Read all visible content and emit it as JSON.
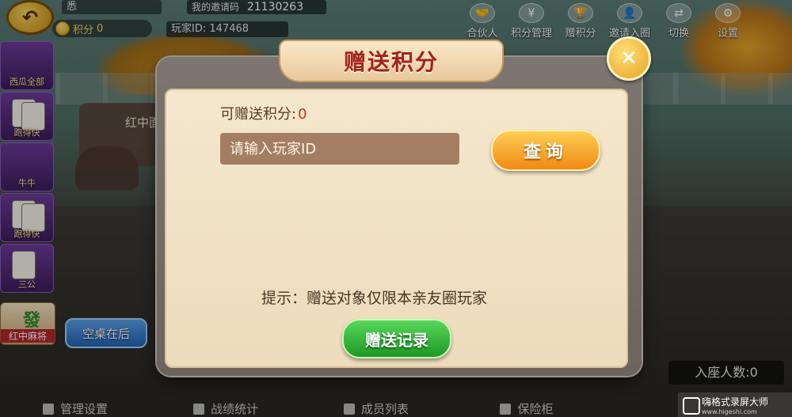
{
  "header": {
    "player_name": "悉",
    "points_label": "积分",
    "points_value": "0",
    "invite_label": "我的邀请码",
    "invite_code": "21130263",
    "player_id_label": "玩家ID:",
    "player_id": "147468"
  },
  "top_nav": [
    {
      "label": "合伙人",
      "icon": "handshake-icon",
      "glyph": "🤝"
    },
    {
      "label": "积分管理",
      "icon": "yen-icon",
      "glyph": "¥"
    },
    {
      "label": "赠积分",
      "icon": "trophy-icon",
      "glyph": "🏆"
    },
    {
      "label": "邀请入圈",
      "icon": "user-add-icon",
      "glyph": "👤"
    },
    {
      "label": "切换",
      "icon": "switch-icon",
      "glyph": "⇄"
    },
    {
      "label": "设置",
      "icon": "gear-icon",
      "glyph": "⚙"
    }
  ],
  "left_games": [
    {
      "label": "西瓜全部"
    },
    {
      "label": "跑得快"
    },
    {
      "label": "牛牛"
    },
    {
      "label": "跑得快"
    },
    {
      "label": "三公"
    }
  ],
  "left_hongzhong": {
    "label": "红中麻将",
    "tile_glyph": "發"
  },
  "background": {
    "table_label": "红中面"
  },
  "empty_table_button": "空桌在后",
  "seated_count": "入座人数:0",
  "bottom_bar": [
    {
      "label": "管理设置"
    },
    {
      "label": "战绩统计"
    },
    {
      "label": "成员列表"
    },
    {
      "label": "保险柜"
    }
  ],
  "watermark": {
    "title": "嗨格式录屏大师",
    "sub": "www.higeshi.com"
  },
  "dialog": {
    "title": "赠送积分",
    "giftable_label": "可赠送积分:",
    "giftable_value": "0",
    "input_placeholder": "请输入玩家ID",
    "query_button": "查询",
    "hint": "提示：赠送对象仅限本亲友圈玩家",
    "record_button": "赠送记录",
    "close_glyph": "✕"
  },
  "colors": {
    "title_red": "#a2231d",
    "query_orange": "#f08a12",
    "record_green": "#1e9a25",
    "input_brown": "#a47e62"
  }
}
